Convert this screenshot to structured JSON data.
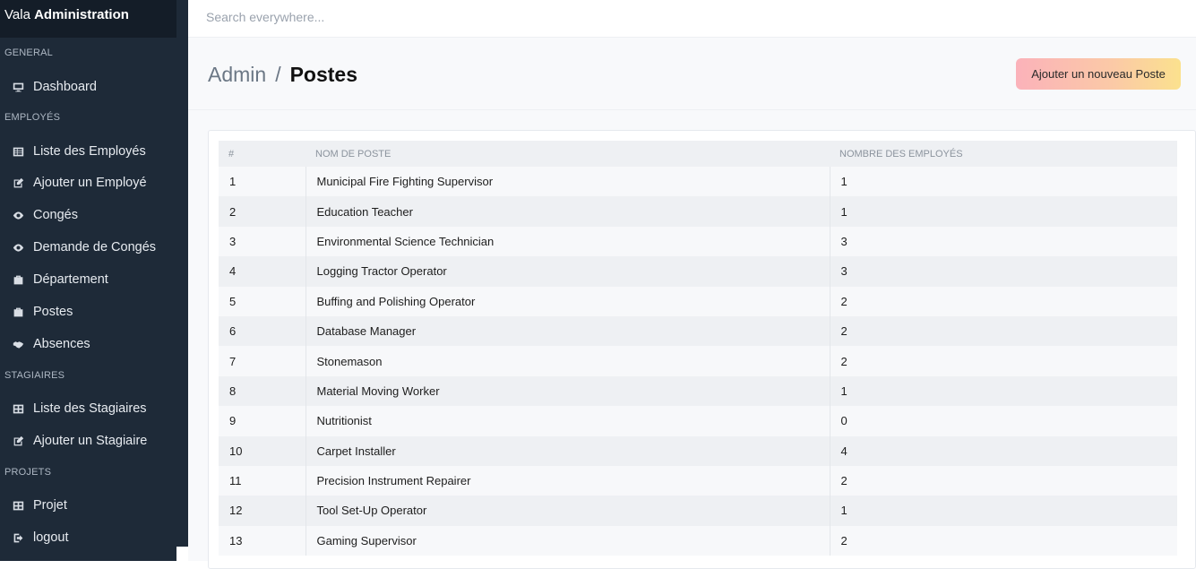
{
  "brand": {
    "prefix": "Vala",
    "bold": "Administration"
  },
  "sidebar": {
    "sections": [
      "GENERAL",
      "EMPLOYÉS",
      "STAGIAIRES",
      "PROJETS"
    ],
    "items": [
      {
        "label": "Dashboard",
        "icon": "monitor-icon"
      },
      {
        "label": "Liste des Employés",
        "icon": "table-icon"
      },
      {
        "label": "Ajouter un Employé",
        "icon": "edit-icon"
      },
      {
        "label": "Congés",
        "icon": "eye-icon"
      },
      {
        "label": "Demande de Congés",
        "icon": "eye-icon"
      },
      {
        "label": "Département",
        "icon": "briefcase-icon"
      },
      {
        "label": "Postes",
        "icon": "briefcase-icon"
      },
      {
        "label": "Absences",
        "icon": "handshake-icon"
      },
      {
        "label": "Liste des Stagiaires",
        "icon": "grid-icon"
      },
      {
        "label": "Ajouter un Stagiaire",
        "icon": "edit-icon"
      },
      {
        "label": "Projet",
        "icon": "grid-icon"
      },
      {
        "label": "logout",
        "icon": "logout-icon"
      }
    ]
  },
  "search": {
    "placeholder": "Search everywhere..."
  },
  "header": {
    "crumb_root": "Admin",
    "crumb_sep": "/",
    "crumb_current": "Postes",
    "add_button": "Ajouter un nouveau Poste"
  },
  "table": {
    "headers": [
      "#",
      "NOM DE POSTE",
      "NOMBRE DES EMPLOYÉS"
    ],
    "rows": [
      [
        "1",
        "Municipal Fire Fighting Supervisor",
        "1"
      ],
      [
        "2",
        "Education Teacher",
        "1"
      ],
      [
        "3",
        "Environmental Science Technician",
        "3"
      ],
      [
        "4",
        "Logging Tractor Operator",
        "3"
      ],
      [
        "5",
        "Buffing and Polishing Operator",
        "2"
      ],
      [
        "6",
        "Database Manager",
        "2"
      ],
      [
        "7",
        "Stonemason",
        "2"
      ],
      [
        "8",
        "Material Moving Worker",
        "1"
      ],
      [
        "9",
        "Nutritionist",
        "0"
      ],
      [
        "10",
        "Carpet Installer",
        "4"
      ],
      [
        "11",
        "Precision Instrument Repairer",
        "2"
      ],
      [
        "12",
        "Tool Set-Up Operator",
        "1"
      ],
      [
        "13",
        "Gaming Supervisor",
        "2"
      ]
    ]
  }
}
